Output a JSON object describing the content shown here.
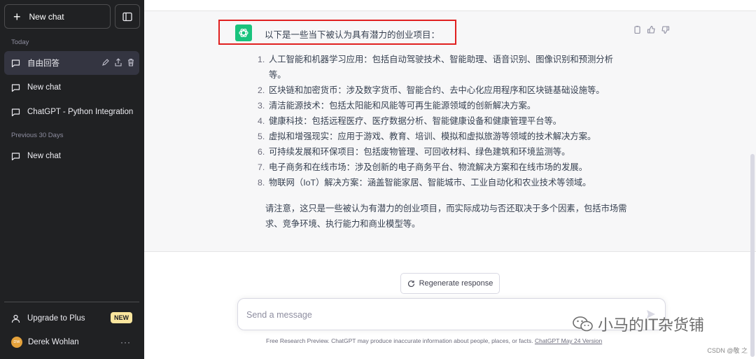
{
  "sidebar": {
    "new_chat_label": "New chat",
    "section_today": "Today",
    "section_previous": "Previous 30 Days",
    "today_items": [
      {
        "label": "自由回答",
        "active": true
      },
      {
        "label": "New chat",
        "active": false
      },
      {
        "label": "ChatGPT - Python Integration",
        "active": false
      }
    ],
    "previous_items": [
      {
        "label": "New chat"
      }
    ],
    "upgrade_label": "Upgrade to Plus",
    "upgrade_badge": "NEW",
    "user_name": "Derek Wohlan",
    "user_initials": "DW"
  },
  "conversation": {
    "intro": "以下是一些当下被认为具有潜力的创业项目：",
    "items": [
      {
        "num": "1.",
        "text": "人工智能和机器学习应用：包括自动驾驶技术、智能助理、语音识别、图像识别和预测分析等。"
      },
      {
        "num": "2.",
        "text": "区块链和加密货币：涉及数字货币、智能合约、去中心化应用程序和区块链基础设施等。"
      },
      {
        "num": "3.",
        "text": "清洁能源技术：包括太阳能和风能等可再生能源领域的创新解决方案。"
      },
      {
        "num": "4.",
        "text": "健康科技：包括远程医疗、医疗数据分析、智能健康设备和健康管理平台等。"
      },
      {
        "num": "5.",
        "text": "虚拟和增强现实：应用于游戏、教育、培训、模拟和虚拟旅游等领域的技术解决方案。"
      },
      {
        "num": "6.",
        "text": "可持续发展和环保项目：包括废物管理、可回收材料、绿色建筑和环境监测等。"
      },
      {
        "num": "7.",
        "text": "电子商务和在线市场：涉及创新的电子商务平台、物流解决方案和在线市场的发展。"
      },
      {
        "num": "8.",
        "text": "物联网（IoT）解决方案：涵盖智能家居、智能城市、工业自动化和农业技术等领域。"
      }
    ],
    "note": "请注意，这只是一些被认为有潜力的创业项目，而实际成功与否还取决于多个因素，包括市场需求、竞争环境、执行能力和商业模型等。"
  },
  "composer": {
    "regenerate_label": "Regenerate response",
    "placeholder": "Send a message"
  },
  "footer": {
    "text": "Free Research Preview. ChatGPT may produce inaccurate information about people, places, or facts.",
    "link": "ChatGPT May 24 Version"
  },
  "watermark": {
    "text": "小马的IT杂货铺",
    "csdn": "CSDN @敬 之"
  },
  "colors": {
    "sidebar_bg": "#202123",
    "answer_bg": "#f7f7f8",
    "gpt_green": "#19c37d",
    "highlight_red": "#e02020",
    "badge_yellow": "#fae69e"
  }
}
